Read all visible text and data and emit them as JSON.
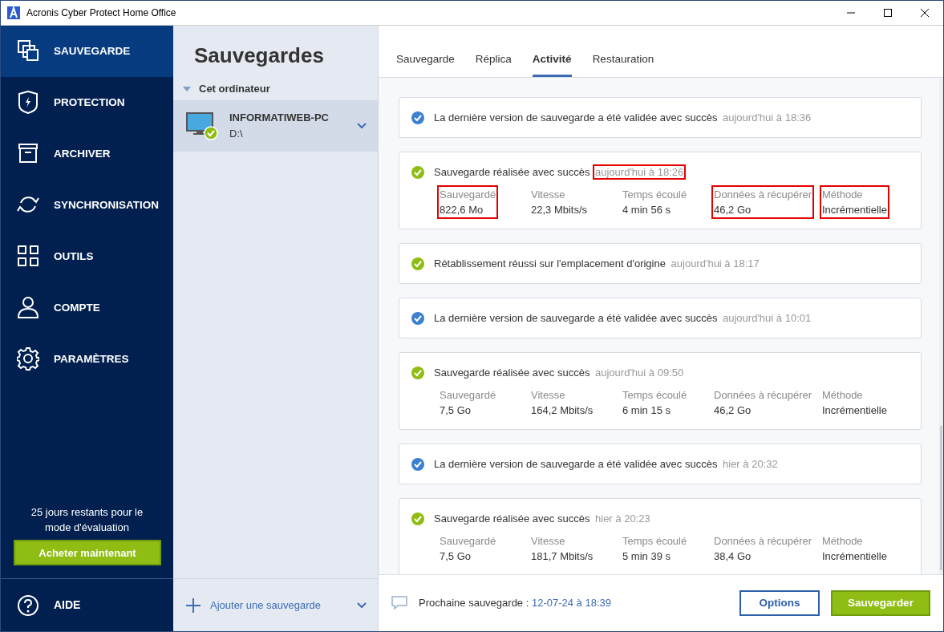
{
  "window": {
    "title": "Acronis Cyber Protect Home Office"
  },
  "sidebar": {
    "items": [
      {
        "label": "SAUVEGARDE",
        "selected": true
      },
      {
        "label": "PROTECTION",
        "selected": false
      },
      {
        "label": "ARCHIVER",
        "selected": false
      },
      {
        "label": "SYNCHRONISATION",
        "selected": false
      },
      {
        "label": "OUTILS",
        "selected": false
      },
      {
        "label": "COMPTE",
        "selected": false
      },
      {
        "label": "PARAMÈTRES",
        "selected": false
      }
    ],
    "trial_text": "25 jours restants pour le mode d'évaluation",
    "buy_button": "Acheter maintenant",
    "help": "AIDE"
  },
  "backups": {
    "title": "Sauvegardes",
    "group": "Cet ordinateur",
    "items": [
      {
        "name": "INFORMATIWEB-PC",
        "target": "D:\\",
        "selected": true
      }
    ],
    "add_button": "Ajouter une sauvegarde"
  },
  "tabs": [
    {
      "label": "Sauvegarde",
      "selected": false
    },
    {
      "label": "Réplica",
      "selected": false
    },
    {
      "label": "Activité",
      "selected": true
    },
    {
      "label": "Restauration",
      "selected": false
    }
  ],
  "events": [
    {
      "kind": "validation",
      "message": "La dernière version de sauvegarde a été validée avec succès",
      "time": "aujourd'hui à 18:36",
      "highlighted": false
    },
    {
      "kind": "backup",
      "message": "Sauvegarde réalisée avec succès",
      "time": "aujourd'hui à 18:26",
      "highlighted": true,
      "details": [
        {
          "label": "Sauvegardé",
          "value": "822,6 Mo",
          "highlighted": true
        },
        {
          "label": "Vitesse",
          "value": "22,3 Mbits/s",
          "highlighted": false
        },
        {
          "label": "Temps écoulé",
          "value": "4 min 56 s",
          "highlighted": false
        },
        {
          "label": "Données à récupérer",
          "value": "46,2 Go",
          "highlighted": true
        },
        {
          "label": "Méthode",
          "value": "Incrémentielle",
          "highlighted": true
        }
      ]
    },
    {
      "kind": "restore",
      "message": "Rétablissement réussi sur l'emplacement d'origine",
      "time": "aujourd'hui à 18:17",
      "highlighted": false
    },
    {
      "kind": "validation",
      "message": "La dernière version de sauvegarde a été validée avec succès",
      "time": "aujourd'hui à 10:01",
      "highlighted": false
    },
    {
      "kind": "backup",
      "message": "Sauvegarde réalisée avec succès",
      "time": "aujourd'hui à 09:50",
      "highlighted": false,
      "details": [
        {
          "label": "Sauvegardé",
          "value": "7,5 Go",
          "highlighted": false
        },
        {
          "label": "Vitesse",
          "value": "164,2 Mbits/s",
          "highlighted": false
        },
        {
          "label": "Temps écoulé",
          "value": "6 min 15 s",
          "highlighted": false
        },
        {
          "label": "Données à récupérer",
          "value": "46,2 Go",
          "highlighted": false
        },
        {
          "label": "Méthode",
          "value": "Incrémentielle",
          "highlighted": false
        }
      ]
    },
    {
      "kind": "validation",
      "message": "La dernière version de sauvegarde a été validée avec succès",
      "time": "hier à 20:32",
      "highlighted": false
    },
    {
      "kind": "backup",
      "message": "Sauvegarde réalisée avec succès",
      "time": "hier à 20:23",
      "highlighted": false,
      "details": [
        {
          "label": "Sauvegardé",
          "value": "7,5 Go",
          "highlighted": false
        },
        {
          "label": "Vitesse",
          "value": "181,7 Mbits/s",
          "highlighted": false
        },
        {
          "label": "Temps écoulé",
          "value": "5 min 39 s",
          "highlighted": false
        },
        {
          "label": "Données à récupérer",
          "value": "38,4 Go",
          "highlighted": false
        },
        {
          "label": "Méthode",
          "value": "Incrémentielle",
          "highlighted": false
        }
      ]
    }
  ],
  "footer": {
    "next_label": "Prochaine sauvegarde :",
    "next_time": "12-07-24 à 18:39",
    "options_button": "Options",
    "backup_button": "Sauvegarder"
  }
}
